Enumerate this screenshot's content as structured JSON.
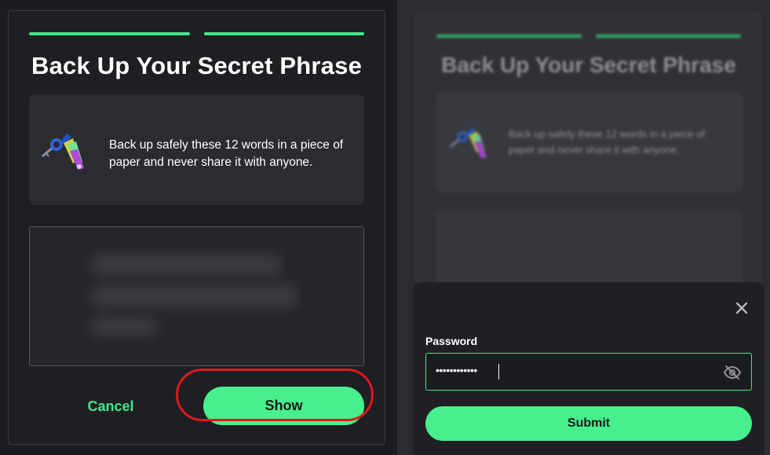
{
  "backup_panel": {
    "title": "Back Up Your Secret Phrase",
    "info_text": "Back up safely these 12 words in a piece of paper and never share it with anyone.",
    "keys_icon": "keys-icon",
    "cancel_label": "Cancel",
    "show_label": "Show"
  },
  "background_panel": {
    "title": "Back Up Your Secret Phrase",
    "info_text": "Back up safely these 12 words in a piece of paper and never share it with anyone."
  },
  "password_modal": {
    "label": "Password",
    "value_masked": "••••••••••••",
    "submit_label": "Submit",
    "close_icon": "close-icon",
    "visibility_icon": "eye-off-icon"
  },
  "colors": {
    "accent": "#48f08d",
    "highlight": "#e0181e",
    "background": "#1e1f22"
  }
}
